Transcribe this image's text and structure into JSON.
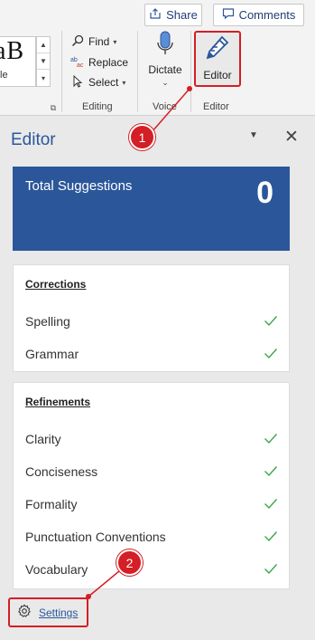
{
  "ribbon": {
    "share_label": "Share",
    "comments_label": "Comments",
    "style_gallery": {
      "sample_text": "aB",
      "style_name": "tle"
    },
    "editing": {
      "find_label": "Find",
      "replace_label": "Replace",
      "select_label": "Select",
      "group_label": "Editing"
    },
    "voice": {
      "dictate_label": "Dictate",
      "group_label": "Voice"
    },
    "editor_group": {
      "editor_label": "Editor",
      "group_label": "Editor"
    }
  },
  "editor_pane": {
    "title": "Editor",
    "total_suggestions": {
      "label": "Total Suggestions",
      "count": "0"
    },
    "corrections": {
      "heading": "Corrections",
      "items": [
        {
          "label": "Spelling",
          "status": "check"
        },
        {
          "label": "Grammar",
          "status": "check"
        }
      ]
    },
    "refinements": {
      "heading": "Refinements",
      "items": [
        {
          "label": "Clarity",
          "status": "check"
        },
        {
          "label": "Conciseness",
          "status": "check"
        },
        {
          "label": "Formality",
          "status": "check"
        },
        {
          "label": "Punctuation Conventions",
          "status": "check"
        },
        {
          "label": "Vocabulary",
          "status": "check"
        }
      ]
    },
    "settings_label": "Settings"
  },
  "callouts": [
    "1",
    "2"
  ],
  "colors": {
    "accent_blue": "#2b579a",
    "callout_red": "#d31f25",
    "check_green": "#3fa34d"
  }
}
